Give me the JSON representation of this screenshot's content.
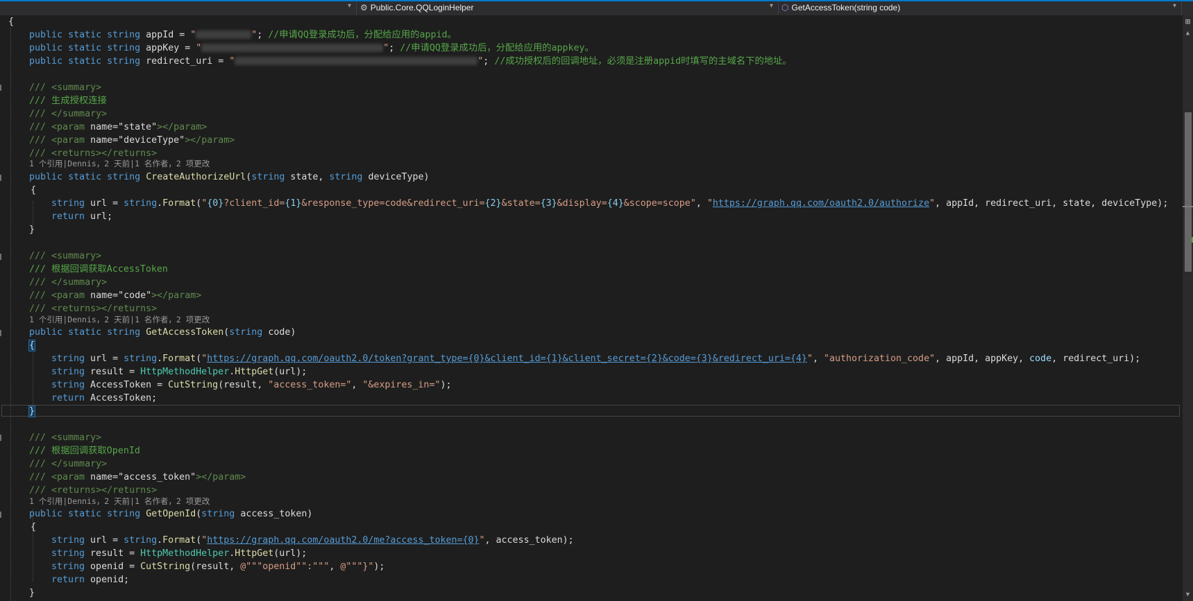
{
  "navbar": {
    "project_dropdown": "",
    "type_dropdown": "Public.Core.QQLoginHelper",
    "member_dropdown": "GetAccessToken(string code)"
  },
  "lenses": [
    "1 个引用|Dennis，2 天前|1 名作者，2 项更改",
    "1 个引用|Dennis，2 天前|1 名作者，2 项更改",
    "1 个引用|Dennis，2 天前|1 名作者，2 项更改"
  ],
  "code": {
    "l01": {
      "t1": "{"
    },
    "l02": {
      "t1": "public",
      "t2": " ",
      "t3": "static",
      "t4": " ",
      "t5": "string",
      "t6": " appId = ",
      "t7": "\"",
      "t8": "\"",
      "t9": "; ",
      "t10": "//申请QQ登录成功后，分配给应用的appid。"
    },
    "l03": {
      "t1": "public",
      "t2": " ",
      "t3": "static",
      "t4": " ",
      "t5": "string",
      "t6": " appKey = ",
      "t7": "\"",
      "t8": "\"",
      "t9": "; ",
      "t10": "//申请QQ登录成功后，分配给应用的appkey。"
    },
    "l04": {
      "t1": "public",
      "t2": " ",
      "t3": "static",
      "t4": " ",
      "t5": "string",
      "t6": " redirect_uri = ",
      "t7": "\"",
      "t8": "\"",
      "t9": "; ",
      "t10": "//成功授权后的回调地址，必须是注册appid时填写的主域名下的地址。"
    },
    "l06": {
      "t1": "/// ",
      "t2": "<summary>"
    },
    "l07": {
      "t1": "/// 生成授权连接"
    },
    "l08": {
      "t1": "/// ",
      "t2": "</summary>"
    },
    "l09": {
      "t1": "/// ",
      "t2": "<param ",
      "t3": "name=",
      "t4": "\"state\"",
      "t5": "></param>"
    },
    "l10": {
      "t1": "/// ",
      "t2": "<param ",
      "t3": "name=",
      "t4": "\"deviceType\"",
      "t5": "></param>"
    },
    "l11": {
      "t1": "/// ",
      "t2": "<returns></returns>"
    },
    "l12": {
      "t1": "public",
      "t2": " ",
      "t3": "static",
      "t4": " ",
      "t5": "string",
      "t6": " ",
      "t7": "CreateAuthorizeUrl",
      "t8": "(",
      "t9": "string",
      "t10": " state, ",
      "t11": "string",
      "t12": " deviceType)"
    },
    "l13": {
      "t1": "{"
    },
    "l14": {
      "t1": "string",
      "t2": " url = ",
      "t3": "string",
      "t4": ".",
      "t5": "Format",
      "t6": "(",
      "t7": "\"",
      "t8": "{0}",
      "t9": "?client_id=",
      "t10": "{1}",
      "t11": "&response_type=code&redirect_uri=",
      "t12": "{2}",
      "t13": "&state=",
      "t14": "{3}",
      "t15": "&display=",
      "t16": "{4}",
      "t17": "&scope=scope\"",
      "t18": ", ",
      "t19": "\"",
      "t20": "https://graph.qq.com/oauth2.0/authorize",
      "t21": "\"",
      "t22": ", appId, redirect_uri, state, deviceType);"
    },
    "l15": {
      "t1": "return",
      "t2": " url;"
    },
    "l16": {
      "t1": "}"
    },
    "l18": {
      "t1": "/// ",
      "t2": "<summary>"
    },
    "l19": {
      "t1": "/// 根据回调获取AccessToken"
    },
    "l20": {
      "t1": "/// ",
      "t2": "</summary>"
    },
    "l21": {
      "t1": "/// ",
      "t2": "<param ",
      "t3": "name=",
      "t4": "\"code\"",
      "t5": "></param>"
    },
    "l22": {
      "t1": "/// ",
      "t2": "<returns></returns>"
    },
    "l23": {
      "t1": "public",
      "t2": " ",
      "t3": "static",
      "t4": " ",
      "t5": "string",
      "t6": " ",
      "t7": "GetAccessToken",
      "t8": "(",
      "t9": "string",
      "t10": " code)"
    },
    "l24": {
      "t1": "{"
    },
    "l25": {
      "t1": "string",
      "t2": " url = ",
      "t3": "string",
      "t4": ".",
      "t5": "Format",
      "t6": "(",
      "t7": "\"",
      "t8": "https://graph.qq.com/oauth2.0/token?grant_type=",
      "t9": "{0}",
      "t10": "&client_id=",
      "t11": "{1}",
      "t12": "&client_secret=",
      "t13": "{2}",
      "t14": "&code=",
      "t15": "{3}",
      "t16": "&redirect_uri=",
      "t17": "{4}",
      "t18": "\"",
      "t19": ", ",
      "t20": "\"authorization_code\"",
      "t21": ", appId, appKey, ",
      "t22": "code",
      "t23": ", redirect_uri);"
    },
    "l26": {
      "t1": "string",
      "t2": " result = ",
      "t3": "HttpMethodHelper",
      "t4": ".",
      "t5": "HttpGet",
      "t6": "(url);"
    },
    "l27": {
      "t1": "string",
      "t2": " AccessToken = ",
      "t3": "CutString",
      "t4": "(result, ",
      "t5": "\"access_token=\"",
      "t6": ", ",
      "t7": "\"&expires_in=\"",
      "t8": ");"
    },
    "l28": {
      "t1": "return",
      "t2": " AccessToken;"
    },
    "l29": {
      "t1": "}"
    },
    "l31": {
      "t1": "/// ",
      "t2": "<summary>"
    },
    "l32": {
      "t1": "/// 根据回调获取OpenId"
    },
    "l33": {
      "t1": "/// ",
      "t2": "</summary>"
    },
    "l34": {
      "t1": "/// ",
      "t2": "<param ",
      "t3": "name=",
      "t4": "\"access_token\"",
      "t5": "></param>"
    },
    "l35": {
      "t1": "/// ",
      "t2": "<returns></returns>"
    },
    "l36": {
      "t1": "public",
      "t2": " ",
      "t3": "static",
      "t4": " ",
      "t5": "string",
      "t6": " ",
      "t7": "GetOpenId",
      "t8": "(",
      "t9": "string",
      "t10": " access_token)"
    },
    "l37": {
      "t1": "{"
    },
    "l38": {
      "t1": "string",
      "t2": " url = ",
      "t3": "string",
      "t4": ".",
      "t5": "Format",
      "t6": "(",
      "t7": "\"",
      "t8": "https://graph.qq.com/oauth2.0/me?access_token=",
      "t9": "{0}",
      "t10": "\"",
      "t11": ", access_token);"
    },
    "l39": {
      "t1": "string",
      "t2": " result = ",
      "t3": "HttpMethodHelper",
      "t4": ".",
      "t5": "HttpGet",
      "t6": "(url);"
    },
    "l40": {
      "t1": "string",
      "t2": " openid = ",
      "t3": "CutString",
      "t4": "(result, ",
      "t5": "@\"\"\"openid\"\":\"\"\"",
      "t6": ", ",
      "t7": "@\"\"\"}\"",
      "t8": ");"
    },
    "l41": {
      "t1": "return",
      "t2": " openid;"
    },
    "l42": {
      "t1": "}"
    }
  },
  "colors": {
    "background": "#1e1e1e",
    "keyword": "#569cd6",
    "type": "#4ec9b0",
    "method": "#dcdcaa",
    "string": "#d69d85",
    "comment": "#57a64a",
    "accent": "#007acc"
  },
  "icons": {
    "type_icon": "class-type-icon",
    "member_icon": "method-cube-icon",
    "split_icon": "split-window-icon"
  }
}
